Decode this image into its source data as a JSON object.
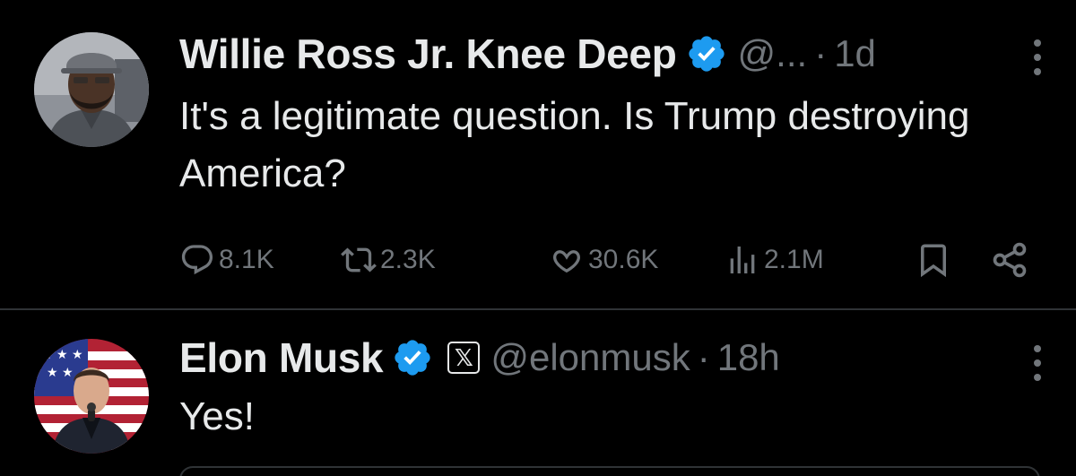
{
  "tweets": [
    {
      "author_name": "Willie Ross Jr. Knee Deep",
      "handle": "@...",
      "separator": "·",
      "time": "1d",
      "verified_icon": "verified-badge-icon",
      "text": "It's a legitimate question. Is Trump destroying America?",
      "stats": {
        "replies": "8.1K",
        "reposts": "2.3K",
        "likes": "30.6K",
        "views": "2.1M"
      }
    },
    {
      "author_name": "Elon Musk",
      "handle": "@elonmusk",
      "separator": "·",
      "time": "18h",
      "verified_icon": "verified-badge-icon",
      "affiliate_badge": "𝕏",
      "text": "Yes!"
    }
  ],
  "colors": {
    "background": "#000000",
    "primary_text": "#e7e9ea",
    "secondary_text": "#71767b",
    "verified_blue": "#1d9bf0",
    "divider": "#2f3336"
  }
}
